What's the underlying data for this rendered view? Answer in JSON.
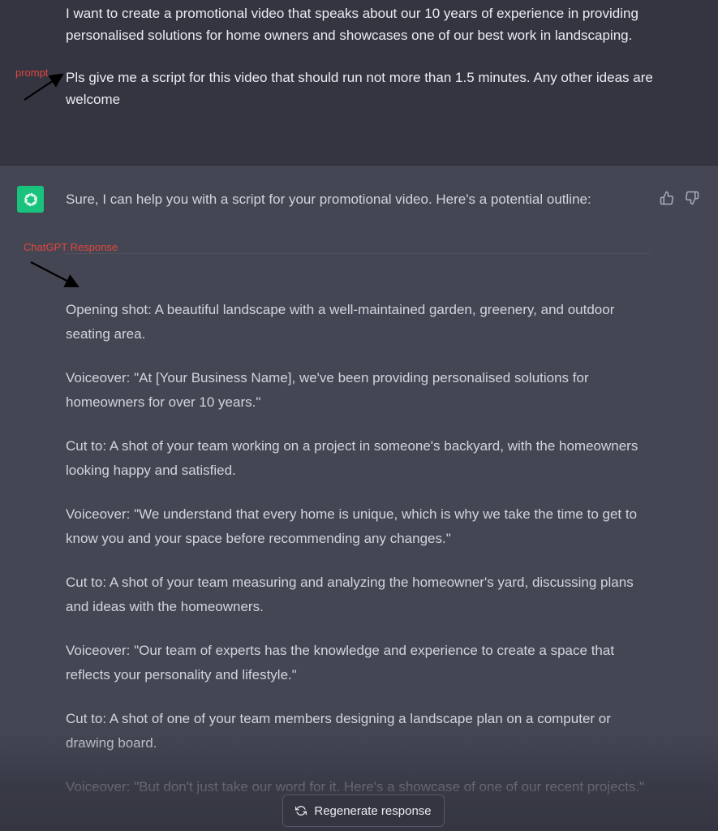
{
  "user_message": {
    "paragraphs": [
      "I want to create a promotional video that speaks about our 10 years of experience in providing personalised solutions for home owners and showcases one of our best work in landscaping.",
      "Pls give me a script for this video that should run not more than 1.5 minutes. Any other ideas are welcome"
    ]
  },
  "annotations": {
    "prompt_label": "prompt",
    "response_label": "ChatGPT Response",
    "color": "#e0463c"
  },
  "assistant_message": {
    "intro": "Sure, I can help you with a script for your promotional video. Here's a potential outline:",
    "paragraphs": [
      "Opening shot: A beautiful landscape with a well-maintained garden, greenery, and outdoor seating area.",
      "Voiceover: \"At [Your Business Name], we've been providing personalised solutions for homeowners for over 10 years.\"",
      "Cut to: A shot of your team working on a project in someone's backyard, with the homeowners looking happy and satisfied.",
      "Voiceover: \"We understand that every home is unique, which is why we take the time to get to know you and your space before recommending any changes.\"",
      "Cut to: A shot of your team measuring and analyzing the homeowner's yard, discussing plans and ideas with the homeowners.",
      "Voiceover: \"Our team of experts has the knowledge and experience to create a space that reflects your personality and lifestyle.\"",
      "Cut to: A shot of one of your team members designing a landscape plan on a computer or drawing board.",
      "Voiceover: \"But don't just take our word for it. Here's a showcase of one of our recent projects.\""
    ]
  },
  "icons": {
    "avatar": "openai-logo-icon",
    "thumb_up": "thumbs-up-icon",
    "thumb_down": "thumbs-down-icon",
    "regenerate": "refresh-icon"
  },
  "controls": {
    "regenerate_label": "Regenerate response"
  },
  "colors": {
    "user_bg": "#343541",
    "assistant_bg": "#444654",
    "avatar_bg": "#19c37d",
    "text": "#d1d5db"
  }
}
